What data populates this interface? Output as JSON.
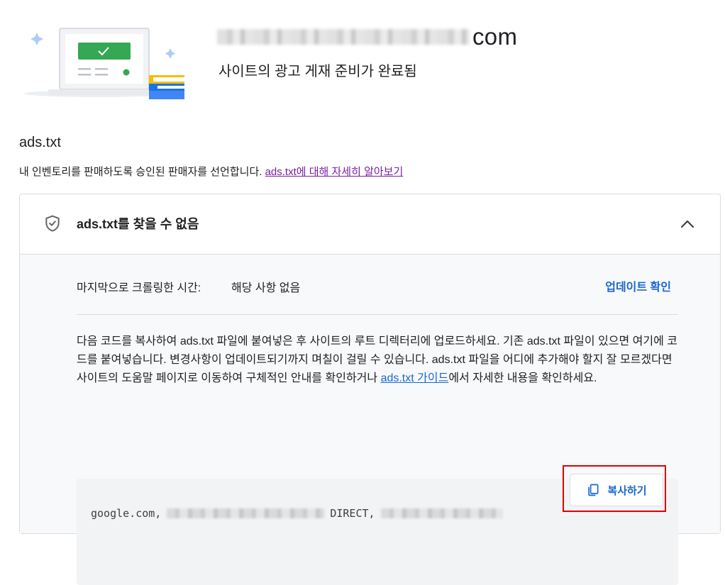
{
  "header": {
    "domain_suffix": "com",
    "site_status": "사이트의 광고 게재 준비가 완료됨"
  },
  "section": {
    "title": "ads.txt",
    "description": "내 인벤토리를 판매하도록 승인된 판매자를 선언합니다. ",
    "learn_more_link": "ads.txt에 대해 자세히 알아보기"
  },
  "card": {
    "title": "ads.txt를 찾을 수 없음",
    "crawl_label": "마지막으로 크롤링한 시간:",
    "crawl_value": "해당 사항 없음",
    "update_link": "업데이트 확인",
    "instructions_before": "다음 코드를 복사하여 ads.txt 파일에 붙여넣은 후 사이트의 루트 디렉터리에 업로드하세요. 기존 ads.txt 파일이 있으면 여기에 코드를 붙여넣습니다. 변경사항이 업데이트되기까지 며칠이 걸릴 수 있습니다. ads.txt 파일을 어디에 추가해야 할지 잘 모르겠다면 사이트의 도움말 페이지로 이동하여 구체적인 안내를 확인하거나 ",
    "guide_link": "ads.txt 가이드",
    "instructions_after": "에서 자세한 내용을 확인하세요.",
    "code": {
      "prefix": "google.com,",
      "middle": "DIRECT,"
    },
    "copy_button": "복사하기"
  },
  "colors": {
    "accent": "#1967d2",
    "link_visited": "#7b1fa2",
    "highlight": "#e10000",
    "success_green": "#34a853"
  }
}
